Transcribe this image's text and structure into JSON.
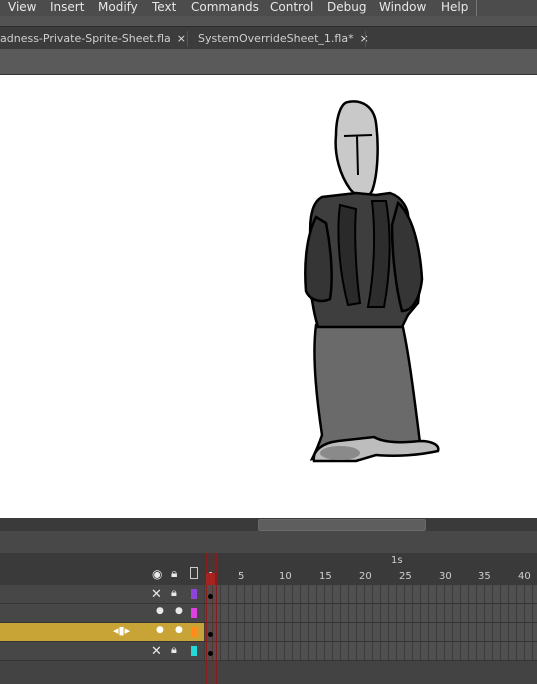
{
  "menu": {
    "items": [
      "View",
      "Insert",
      "Modify",
      "Text",
      "Commands",
      "Control",
      "Debug",
      "Window",
      "Help"
    ]
  },
  "tabs": [
    {
      "label": "adness-Private-Sprite-Sheet.fla",
      "close": "×"
    },
    {
      "label": "SystemOverrideSheet_1.fla*",
      "close": "×"
    }
  ],
  "timeline": {
    "time_marker": "1s",
    "frame_numbers": [
      "1",
      "5",
      "10",
      "15",
      "20",
      "25",
      "30",
      "35",
      "40"
    ],
    "layer_colors": [
      "#8e44d8",
      "#e040e0",
      "#ff8c1a",
      "#22d8d8"
    ]
  },
  "colors": {
    "stage": "#ffffff",
    "active_layer": "#c8a436",
    "playhead": "#a82222"
  }
}
